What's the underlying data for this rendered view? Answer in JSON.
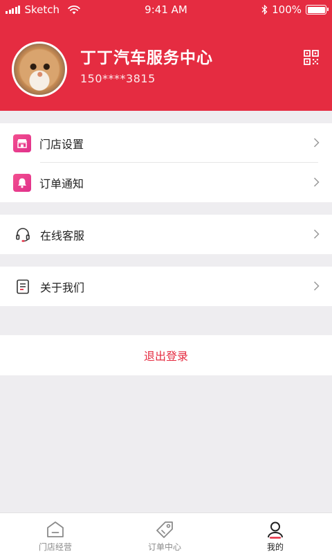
{
  "status_bar": {
    "carrier": "Sketch",
    "time": "9:41 AM",
    "battery": "100%"
  },
  "profile": {
    "name": "丁丁汽车服务中心",
    "phone": "150****3815"
  },
  "menu": {
    "store_settings": "门店设置",
    "order_notification": "订单通知",
    "online_service": "在线客服",
    "about_us": "关于我们"
  },
  "logout_label": "退出登录",
  "tabs": [
    {
      "label": "门店经营",
      "icon": "home-icon",
      "active": false
    },
    {
      "label": "订单中心",
      "icon": "tag-icon",
      "active": false
    },
    {
      "label": "我的",
      "icon": "user-icon",
      "active": true
    }
  ],
  "colors": {
    "brand_red": "#e52c41",
    "icon_pink": "#e0308b",
    "background": "#eeedf0"
  }
}
